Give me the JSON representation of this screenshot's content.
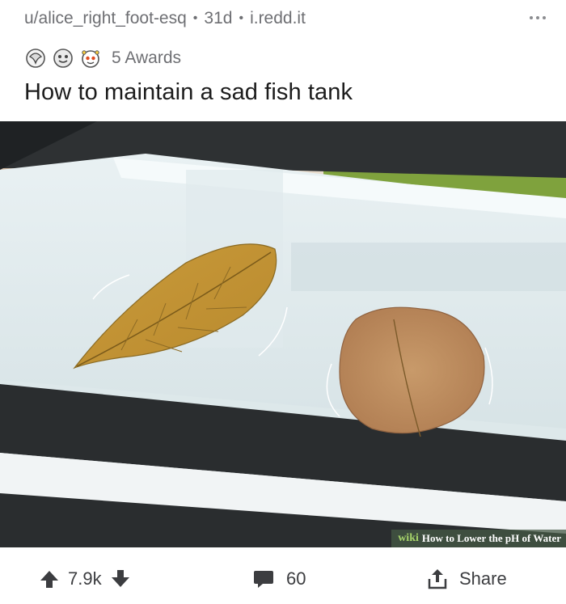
{
  "post": {
    "author": "u/alice_right_foot-esq",
    "age": "31d",
    "domain": "i.redd.it",
    "awards_count_label": "5 Awards",
    "title": "How to maintain a sad fish tank"
  },
  "image": {
    "watermark_brand": "wiki",
    "watermark_text": "How to Lower the pH of Water"
  },
  "actions": {
    "score": "7.9k",
    "comments": "60",
    "share_label": "Share"
  },
  "icons": [
    "more-icon",
    "award-icon",
    "upvote-icon",
    "downvote-icon",
    "comment-icon",
    "share-icon"
  ],
  "colors": {
    "meta_text": "#6e6f73",
    "title_text": "#1c1c1c",
    "action_text": "#3c3d40"
  }
}
